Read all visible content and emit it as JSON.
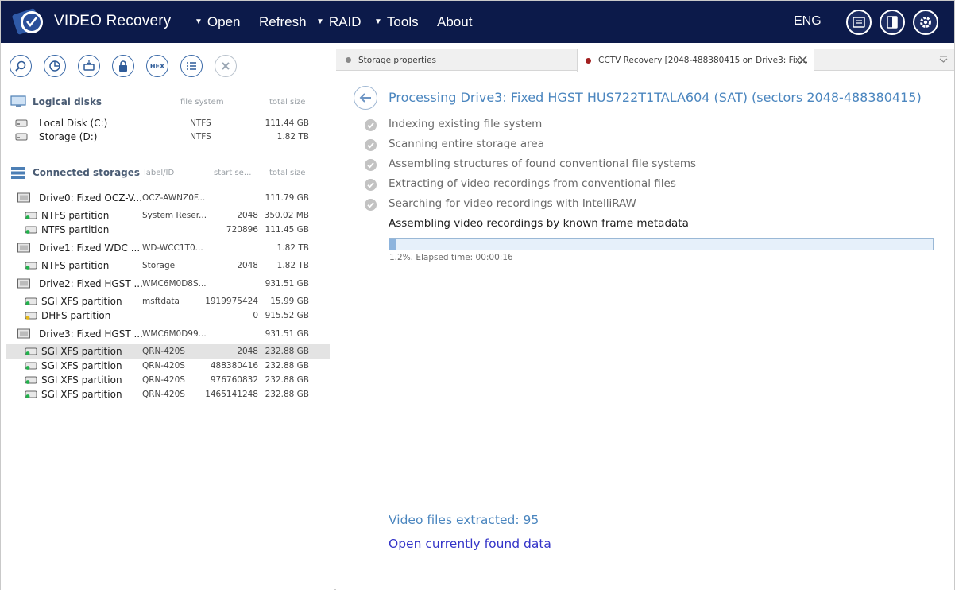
{
  "app": {
    "title": "VIDEO Recovery"
  },
  "menu": [
    {
      "label": "Open",
      "dropdown": true
    },
    {
      "label": "Refresh",
      "dropdown": false
    },
    {
      "label": "RAID",
      "dropdown": true
    },
    {
      "label": "Tools",
      "dropdown": true
    },
    {
      "label": "About",
      "dropdown": false
    }
  ],
  "header": {
    "language": "ENG"
  },
  "toolbar": {
    "hex_label": "HEX"
  },
  "logical_disks": {
    "title": "Logical disks",
    "col_fs": "file system",
    "col_size": "total size",
    "items": [
      {
        "name": "Local Disk (C:)",
        "fs": "NTFS",
        "size": "111.44 GB"
      },
      {
        "name": "Storage (D:)",
        "fs": "NTFS",
        "size": "1.82 TB"
      }
    ]
  },
  "storages": {
    "title": "Connected storages",
    "col_label": "label/ID",
    "col_start": "start se...",
    "col_size": "total size",
    "rows": [
      {
        "type": "drive",
        "name": "Drive0: Fixed OCZ-V...",
        "label": "OCZ-AWNZ0F...",
        "start": "",
        "size": "111.79 GB"
      },
      {
        "type": "part",
        "name": "NTFS partition",
        "label": "System Reser...",
        "start": "2048",
        "size": "350.02 MB"
      },
      {
        "type": "part",
        "name": "NTFS partition",
        "label": "",
        "start": "720896",
        "size": "111.45 GB"
      },
      {
        "type": "drive",
        "name": "Drive1: Fixed WDC ...",
        "label": "WD-WCC1T0...",
        "start": "",
        "size": "1.82 TB"
      },
      {
        "type": "part",
        "name": "NTFS partition",
        "label": "Storage",
        "start": "2048",
        "size": "1.82 TB"
      },
      {
        "type": "drive",
        "name": "Drive2: Fixed HGST ...",
        "label": "WMC6M0D8S...",
        "start": "",
        "size": "931.51 GB"
      },
      {
        "type": "part",
        "name": "SGI XFS partition",
        "label": "msftdata",
        "start": "1919975424",
        "size": "15.99 GB"
      },
      {
        "type": "part-yellow",
        "name": "DHFS partition",
        "label": "",
        "start": "0",
        "size": "915.52 GB"
      },
      {
        "type": "drive",
        "name": "Drive3: Fixed HGST ...",
        "label": "WMC6M0D99...",
        "start": "",
        "size": "931.51 GB"
      },
      {
        "type": "part",
        "name": "SGI XFS partition",
        "label": "QRN-420S",
        "start": "2048",
        "size": "232.88 GB",
        "selected": true
      },
      {
        "type": "part",
        "name": "SGI XFS partition",
        "label": "QRN-420S",
        "start": "488380416",
        "size": "232.88 GB"
      },
      {
        "type": "part",
        "name": "SGI XFS partition",
        "label": "QRN-420S",
        "start": "976760832",
        "size": "232.88 GB"
      },
      {
        "type": "part",
        "name": "SGI XFS partition",
        "label": "QRN-420S",
        "start": "1465141248",
        "size": "232.88 GB"
      }
    ]
  },
  "tabs": [
    {
      "label": "Storage properties",
      "dot_color": "#8a8a8a",
      "active": false
    },
    {
      "label": "CCTV Recovery [2048-488380415 on Drive3: Fix...",
      "dot_color": "#a32020",
      "active": true
    }
  ],
  "processing": {
    "title": "Processing Drive3: Fixed HGST HUS722T1TALA604 (SAT) (sectors 2048-488380415)",
    "steps": [
      {
        "label": "Indexing existing file system",
        "done": true
      },
      {
        "label": "Scanning entire storage area",
        "done": true
      },
      {
        "label": "Assembling structures of found conventional file systems",
        "done": true
      },
      {
        "label": "Extracting of video recordings from conventional files",
        "done": true
      },
      {
        "label": "Searching for video recordings with IntelliRAW",
        "done": true
      },
      {
        "label": "Assembling video recordings by known frame metadata",
        "done": false
      }
    ],
    "progress_percent": 1.2,
    "progress_text": "1.2%. Elapsed time: 00:00:16",
    "found_text": "Video files extracted: 95",
    "open_link": "Open currently found data"
  },
  "colors": {
    "topbar": "#0c1a4a",
    "accent": "#4b86bf",
    "link": "#3434c8"
  }
}
